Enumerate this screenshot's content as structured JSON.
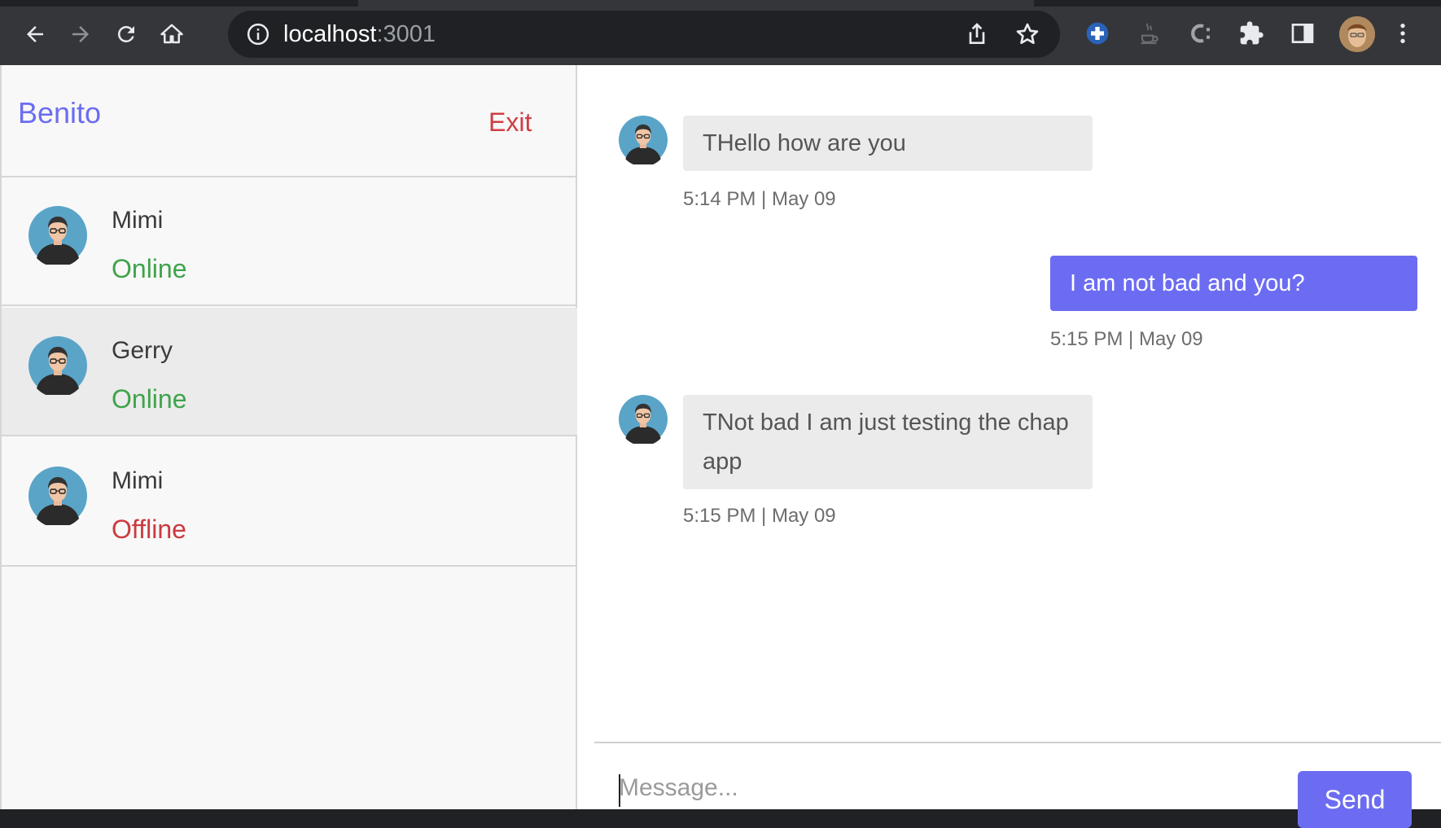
{
  "browser": {
    "url_host": "localhost",
    "url_port": ":3001"
  },
  "sidebar": {
    "current_user": "Benito",
    "exit_label": "Exit",
    "contacts": [
      {
        "name": "Mimi",
        "status": "Online"
      },
      {
        "name": "Gerry",
        "status": "Online"
      },
      {
        "name": "Mimi",
        "status": "Offline"
      }
    ]
  },
  "chat": {
    "messages": [
      {
        "direction": "incoming",
        "text": "THello how are you",
        "time": "5:14 PM | May 09"
      },
      {
        "direction": "outgoing",
        "text": "I am not bad and you?",
        "time": "5:15 PM | May 09"
      },
      {
        "direction": "incoming",
        "text": "TNot bad I am just testing the chap app",
        "time": "5:15 PM | May 09"
      }
    ],
    "input_placeholder": "Message...",
    "send_label": "Send"
  },
  "colors": {
    "accent": "#6c6cf2",
    "online": "#3fa34a",
    "offline": "#cc3a3f",
    "exit": "#d03e44"
  }
}
